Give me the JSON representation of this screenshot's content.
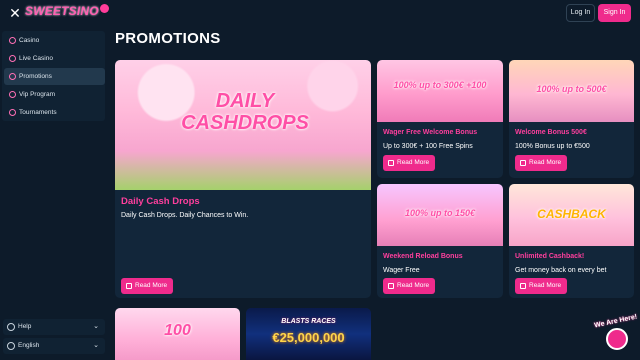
{
  "header": {
    "logo_text": "SWEETSINO",
    "login_label": "Log In",
    "signup_label": "Sign In"
  },
  "sidebar": {
    "items": [
      {
        "label": "Casino",
        "icon": "casino-icon"
      },
      {
        "label": "Live Casino",
        "icon": "live-casino-icon"
      },
      {
        "label": "Promotions",
        "icon": "promotions-icon",
        "active": true
      },
      {
        "label": "Vip Program",
        "icon": "vip-icon"
      },
      {
        "label": "Tournaments",
        "icon": "trophy-icon"
      }
    ],
    "help_label": "Help",
    "language_label": "English"
  },
  "main": {
    "title": "PROMOTIONS",
    "cards": [
      {
        "title": "Daily Cash Drops",
        "desc": "Daily Cash Drops. Daily Chances to Win.",
        "button": "Read More",
        "banner": "DAILY CASHDROPS"
      },
      {
        "title": "Wager Free Welcome Bonus",
        "desc": "Up to 300€ + 100 Free Spins",
        "button": "Read More",
        "banner": "100% up to 300€ +100"
      },
      {
        "title": "Welcome Bonus 500€",
        "desc": "100% Bonus up to €500",
        "button": "Read More",
        "banner": "100% up to 500€"
      },
      {
        "title": "Weekend Reload Bonus",
        "desc": "Wager Free",
        "button": "Read More",
        "banner": "100% up to 150€"
      },
      {
        "title": "Unlimited Cashback!",
        "desc": "Get money back on every bet",
        "button": "Read More",
        "banner": "CASHBACK"
      },
      {
        "banner": "100"
      },
      {
        "banner": "BLASTS RACES",
        "banner_sub": "€25,000,000"
      }
    ]
  },
  "badge": {
    "text": "We Are Here!"
  },
  "colors": {
    "accent": "#ef2b8c",
    "background": "#0d1b2a",
    "card": "#12263a",
    "title_pink": "#ff3f9d"
  }
}
